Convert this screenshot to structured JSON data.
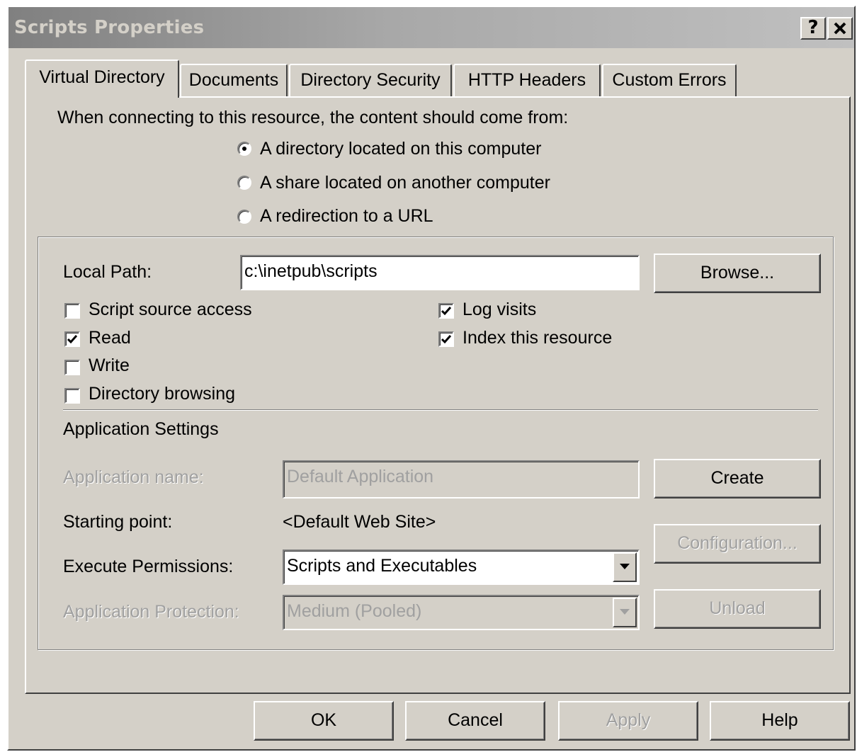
{
  "window": {
    "title": "Scripts Properties",
    "help_glyph": "?",
    "close_glyph": "✕"
  },
  "tabs": [
    {
      "label": "Virtual Directory",
      "active": true
    },
    {
      "label": "Documents",
      "active": false
    },
    {
      "label": "Directory Security",
      "active": false
    },
    {
      "label": "HTTP Headers",
      "active": false
    },
    {
      "label": "Custom Errors",
      "active": false
    }
  ],
  "content_source": {
    "prompt": "When connecting to this resource, the content should come from:",
    "options": [
      {
        "label": "A directory located on this computer",
        "selected": true
      },
      {
        "label": "A share located on another computer",
        "selected": false
      },
      {
        "label": "A redirection to a URL",
        "selected": false
      }
    ]
  },
  "local_path": {
    "label": "Local Path:",
    "value": "c:\\inetpub\\scripts",
    "browse_label": "Browse..."
  },
  "permissions_left": [
    {
      "label": "Script source access",
      "checked": false
    },
    {
      "label": "Read",
      "checked": true
    },
    {
      "label": "Write",
      "checked": false
    },
    {
      "label": "Directory browsing",
      "checked": false
    }
  ],
  "permissions_right": [
    {
      "label": "Log visits",
      "checked": true
    },
    {
      "label": "Index this resource",
      "checked": true
    }
  ],
  "app_settings": {
    "heading": "Application Settings",
    "app_name_label": "Application name:",
    "app_name_value": "Default Application",
    "create_label": "Create",
    "starting_point_label": "Starting point:",
    "starting_point_value": "<Default Web Site>",
    "configuration_label": "Configuration...",
    "execute_label": "Execute Permissions:",
    "execute_value": "Scripts and Executables",
    "protection_label": "Application Protection:",
    "protection_value": "Medium (Pooled)",
    "unload_label": "Unload"
  },
  "footer": {
    "ok": "OK",
    "cancel": "Cancel",
    "apply": "Apply",
    "help": "Help"
  },
  "colors": {
    "face": "#d4d0c8",
    "title_gradient_start": "#808080",
    "disabled_text": "#a0a0a0"
  }
}
